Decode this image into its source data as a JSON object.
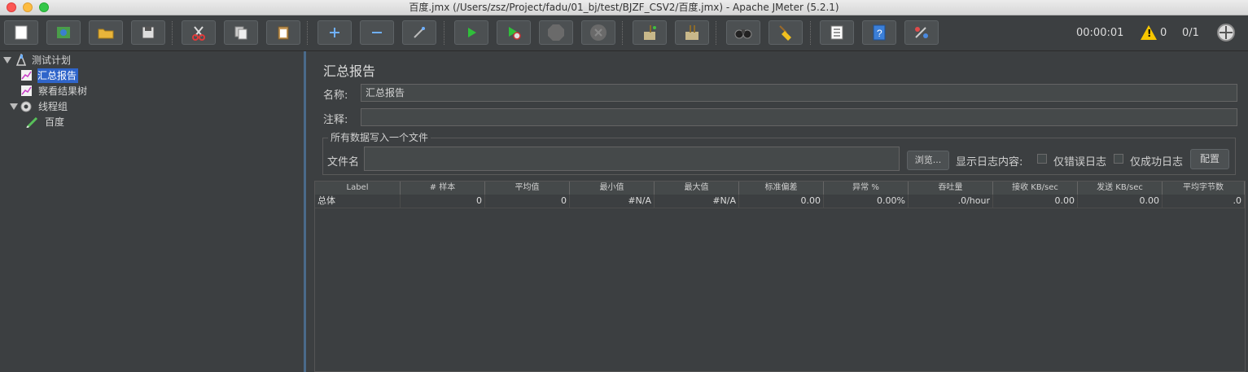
{
  "window": {
    "title": "百度.jmx (/Users/zsz/Project/fadu/01_bj/test/BJZF_CSV2/百度.jmx) - Apache JMeter (5.2.1)"
  },
  "toolbar": {
    "buttons": [
      {
        "name": "new-button",
        "icon": "new-file-icon"
      },
      {
        "name": "templates-button",
        "icon": "templates-icon"
      },
      {
        "name": "open-button",
        "icon": "open-folder-icon"
      },
      {
        "name": "save-button",
        "icon": "save-icon"
      },
      {
        "name": "cut-button",
        "icon": "scissors-icon"
      },
      {
        "name": "copy-button",
        "icon": "copy-icon"
      },
      {
        "name": "paste-button",
        "icon": "paste-icon"
      },
      {
        "name": "expand-all-button",
        "icon": "plus-icon"
      },
      {
        "name": "collapse-all-button",
        "icon": "minus-icon"
      },
      {
        "name": "toggle-button",
        "icon": "toggle-wand-icon"
      },
      {
        "name": "start-button",
        "icon": "play-icon"
      },
      {
        "name": "start-no-pause-button",
        "icon": "play-no-timers-icon"
      },
      {
        "name": "stop-button",
        "icon": "stop-icon"
      },
      {
        "name": "shutdown-button",
        "icon": "shutdown-icon"
      },
      {
        "name": "clear-button",
        "icon": "clear-broom-icon"
      },
      {
        "name": "clear-all-button",
        "icon": "clear-all-broom-icon"
      },
      {
        "name": "search-button",
        "icon": "binoculars-icon"
      },
      {
        "name": "reset-search-button",
        "icon": "reset-broom-icon"
      },
      {
        "name": "function-helper-button",
        "icon": "function-list-icon"
      },
      {
        "name": "help-button",
        "icon": "help-book-icon"
      },
      {
        "name": "remote-button",
        "icon": "remote-icon"
      }
    ],
    "elapsed_time": "00:00:01",
    "warnings_count": "0",
    "threads": "0/1"
  },
  "tree": {
    "items": [
      {
        "label": "测试计划",
        "icon": "test-plan-icon"
      },
      {
        "label": "汇总报告",
        "icon": "report-chart-icon"
      },
      {
        "label": "察看结果树",
        "icon": "report-chart-icon"
      },
      {
        "label": "线程组",
        "icon": "gear-icon"
      },
      {
        "label": "百度",
        "icon": "http-sampler-pen-icon"
      }
    ]
  },
  "panel": {
    "title": "汇总报告",
    "name_label": "名称:",
    "name_value": "汇总报告",
    "comment_label": "注释:",
    "comment_value": "",
    "file_group_title": "所有数据写入一个文件",
    "filename_label": "文件名",
    "filename_value": "",
    "browse_label": "浏览...",
    "log_display_label": "显示日志内容:",
    "errors_only_label": "仅错误日志",
    "success_only_label": "仅成功日志",
    "configure_label": "配置"
  },
  "table": {
    "columns": [
      "Label",
      "# 样本",
      "平均值",
      "最小值",
      "最大值",
      "标准偏差",
      "异常 %",
      "吞吐量",
      "接收 KB/sec",
      "发送 KB/sec",
      "平均字节数"
    ],
    "rows": [
      [
        "总体",
        "0",
        "0",
        "#N/A",
        "#N/A",
        "0.00",
        "0.00%",
        ".0/hour",
        "0.00",
        "0.00",
        ".0"
      ]
    ]
  }
}
